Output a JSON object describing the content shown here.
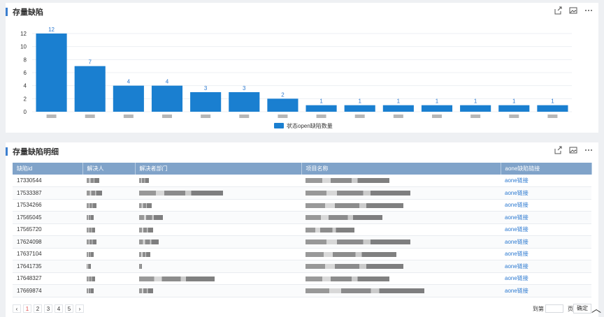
{
  "top_panel": {
    "title": "存量缺陷"
  },
  "chart_data": {
    "type": "bar",
    "categories": [
      "",
      "",
      "",
      "",
      "",
      "",
      "",
      "",
      "",
      "",
      "",
      "",
      "",
      ""
    ],
    "values": [
      12,
      7,
      4,
      4,
      3,
      3,
      2,
      1,
      1,
      1,
      1,
      1,
      1,
      1
    ],
    "series_name": "状态open缺陷数量",
    "ylim": [
      0,
      12
    ],
    "yticks": [
      "0",
      "2",
      "4",
      "6",
      "8",
      "10",
      "12"
    ],
    "grid": true,
    "legend": "bottom-center",
    "color": "#1a7fd0"
  },
  "detail_panel": {
    "title": "存量缺陷明细",
    "columns": [
      "缺陷id",
      "解决人",
      "解决者部门",
      "项目名称",
      "aone缺陷链接"
    ],
    "rows": [
      {
        "id": "17330544",
        "link": "aone链接"
      },
      {
        "id": "17533387",
        "link": "aone链接"
      },
      {
        "id": "17534266",
        "link": "aone链接"
      },
      {
        "id": "17565045",
        "link": "aone链接"
      },
      {
        "id": "17565720",
        "link": "aone链接"
      },
      {
        "id": "17624098",
        "link": "aone链接"
      },
      {
        "id": "17637104",
        "link": "aone链接"
      },
      {
        "id": "17641735",
        "link": "aone链接"
      },
      {
        "id": "17648327",
        "link": "aone链接"
      },
      {
        "id": "17669874",
        "link": "aone链接"
      }
    ]
  },
  "pager": {
    "prev": "‹",
    "pages": [
      "1",
      "2",
      "3",
      "4",
      "5"
    ],
    "next": "›",
    "goto_label": "到第",
    "page_unit": "页",
    "confirm": "确定"
  },
  "icons": [
    "share-icon",
    "image-icon",
    "more-icon",
    "back-to-top-icon"
  ]
}
